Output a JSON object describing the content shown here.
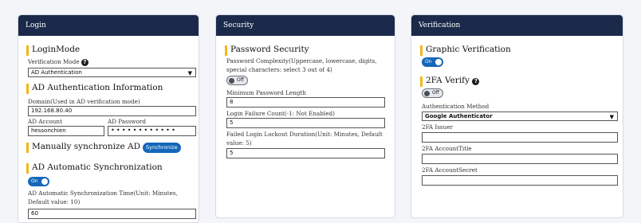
{
  "login": {
    "header": "Login",
    "login_mode_title": "LoginMode",
    "verification_mode_label": "Verification Mode",
    "verification_mode_value": "AD Authentication",
    "ad_info_title": "AD Authentication Information",
    "domain_label": "Domain(Used in AD verification mode)",
    "domain_value": "192.168.80.40",
    "ad_account_label": "AD Account",
    "ad_account_value": "hessonchien",
    "ad_password_label": "AD Password",
    "ad_password_value": "••••••••••••",
    "manual_sync_title": "Manually synchronize AD",
    "sync_button": "Synchronize",
    "auto_sync_title": "AD Automatic Synchronization",
    "auto_sync_toggle": "On",
    "auto_sync_time_label": "AD Automatic Synchronization Time(Unit: Minutes, Default value: 10)",
    "auto_sync_time_value": "60"
  },
  "security": {
    "header": "Security",
    "password_security_title": "Password Security",
    "password_complexity_label": "Password Complexity(Uppercase, lowercase, digits, special characters: select 3 out of 4)",
    "password_complexity_toggle": "Off",
    "min_length_label": "Minimum Password Length",
    "min_length_value": "8",
    "failure_count_label": "Login Failure Count(-1: Not Enabled)",
    "failure_count_value": "5",
    "lockout_label": "Failed Login Lockout Duration(Unit: Minutes, Default value: 5)",
    "lockout_value": "5"
  },
  "verification": {
    "header": "Verification",
    "graphic_title": "Graphic Verification",
    "graphic_toggle": "On",
    "twofa_title": "2FA Verify",
    "twofa_toggle": "Off",
    "auth_method_label": "Authentication Method",
    "auth_method_value": "Google Authenticator",
    "issuer_label": "2FA Issuer",
    "issuer_value": "",
    "account_title_label": "2FA AccountTitle",
    "account_title_value": "",
    "account_secret_label": "2FA AccountSecret",
    "account_secret_value": ""
  },
  "colors": {
    "header_bg": "#1b2a4a",
    "accent_bar": "#f3b715",
    "toggle_on": "#1568b9"
  }
}
